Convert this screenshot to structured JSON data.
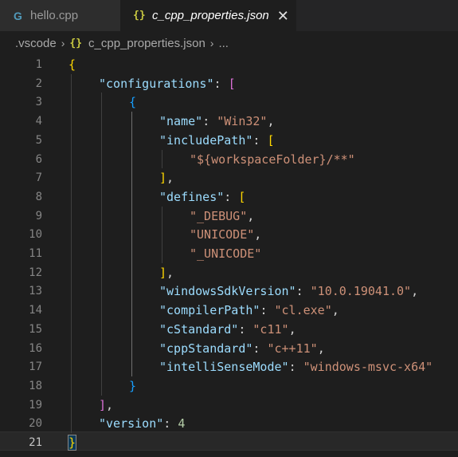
{
  "tabs": [
    {
      "icon": "G",
      "label": "hello.cpp",
      "active": false
    },
    {
      "icon": "{}",
      "label": "c_cpp_properties.json",
      "active": true,
      "close": "✕"
    }
  ],
  "breadcrumb": {
    "folder": ".vscode",
    "sep": "›",
    "json_icon": "{}",
    "file": "c_cpp_properties.json",
    "ellipsis": "..."
  },
  "colors": {
    "key": "#9cdcfe",
    "string": "#ce9178",
    "number": "#b5cea8",
    "bracket1": "#ffd700",
    "bracket2": "#da70d6",
    "bracket3": "#179fff"
  },
  "code_lines": [
    {
      "n": "1",
      "indent": 0,
      "tokens": [
        [
          "{",
          "b1"
        ]
      ]
    },
    {
      "n": "2",
      "indent": 1,
      "tokens": [
        [
          "\"configurations\"",
          "key"
        ],
        [
          ": ",
          "punc"
        ],
        [
          "[",
          "b2"
        ]
      ]
    },
    {
      "n": "3",
      "indent": 2,
      "tokens": [
        [
          "{",
          "b3"
        ]
      ]
    },
    {
      "n": "4",
      "indent": 3,
      "tokens": [
        [
          "\"name\"",
          "key"
        ],
        [
          ": ",
          "punc"
        ],
        [
          "\"Win32\"",
          "str"
        ],
        [
          ",",
          "punc"
        ]
      ]
    },
    {
      "n": "5",
      "indent": 3,
      "tokens": [
        [
          "\"includePath\"",
          "key"
        ],
        [
          ": ",
          "punc"
        ],
        [
          "[",
          "b1"
        ]
      ]
    },
    {
      "n": "6",
      "indent": 4,
      "tokens": [
        [
          "\"${workspaceFolder}/**\"",
          "str"
        ]
      ]
    },
    {
      "n": "7",
      "indent": 3,
      "tokens": [
        [
          "]",
          "b1"
        ],
        [
          ",",
          "punc"
        ]
      ]
    },
    {
      "n": "8",
      "indent": 3,
      "tokens": [
        [
          "\"defines\"",
          "key"
        ],
        [
          ": ",
          "punc"
        ],
        [
          "[",
          "b1"
        ]
      ]
    },
    {
      "n": "9",
      "indent": 4,
      "tokens": [
        [
          "\"_DEBUG\"",
          "str"
        ],
        [
          ",",
          "punc"
        ]
      ]
    },
    {
      "n": "10",
      "indent": 4,
      "tokens": [
        [
          "\"UNICODE\"",
          "str"
        ],
        [
          ",",
          "punc"
        ]
      ]
    },
    {
      "n": "11",
      "indent": 4,
      "tokens": [
        [
          "\"_UNICODE\"",
          "str"
        ]
      ]
    },
    {
      "n": "12",
      "indent": 3,
      "tokens": [
        [
          "]",
          "b1"
        ],
        [
          ",",
          "punc"
        ]
      ]
    },
    {
      "n": "13",
      "indent": 3,
      "tokens": [
        [
          "\"windowsSdkVersion\"",
          "key"
        ],
        [
          ": ",
          "punc"
        ],
        [
          "\"10.0.19041.0\"",
          "str"
        ],
        [
          ",",
          "punc"
        ]
      ]
    },
    {
      "n": "14",
      "indent": 3,
      "tokens": [
        [
          "\"compilerPath\"",
          "key"
        ],
        [
          ": ",
          "punc"
        ],
        [
          "\"cl.exe\"",
          "str"
        ],
        [
          ",",
          "punc"
        ]
      ]
    },
    {
      "n": "15",
      "indent": 3,
      "tokens": [
        [
          "\"cStandard\"",
          "key"
        ],
        [
          ": ",
          "punc"
        ],
        [
          "\"c11\"",
          "str"
        ],
        [
          ",",
          "punc"
        ]
      ]
    },
    {
      "n": "16",
      "indent": 3,
      "tokens": [
        [
          "\"cppStandard\"",
          "key"
        ],
        [
          ": ",
          "punc"
        ],
        [
          "\"c++11\"",
          "str"
        ],
        [
          ",",
          "punc"
        ]
      ]
    },
    {
      "n": "17",
      "indent": 3,
      "tokens": [
        [
          "\"intelliSenseMode\"",
          "key"
        ],
        [
          ": ",
          "punc"
        ],
        [
          "\"windows-msvc-x64\"",
          "str"
        ]
      ]
    },
    {
      "n": "18",
      "indent": 2,
      "tokens": [
        [
          "}",
          "b3"
        ]
      ]
    },
    {
      "n": "19",
      "indent": 1,
      "tokens": [
        [
          "]",
          "b2"
        ],
        [
          ",",
          "punc"
        ]
      ]
    },
    {
      "n": "20",
      "indent": 1,
      "tokens": [
        [
          "\"version\"",
          "key"
        ],
        [
          ": ",
          "punc"
        ],
        [
          "4",
          "num"
        ]
      ]
    },
    {
      "n": "21",
      "indent": 0,
      "tokens": [
        [
          "}",
          "b1"
        ]
      ],
      "current": true
    }
  ]
}
